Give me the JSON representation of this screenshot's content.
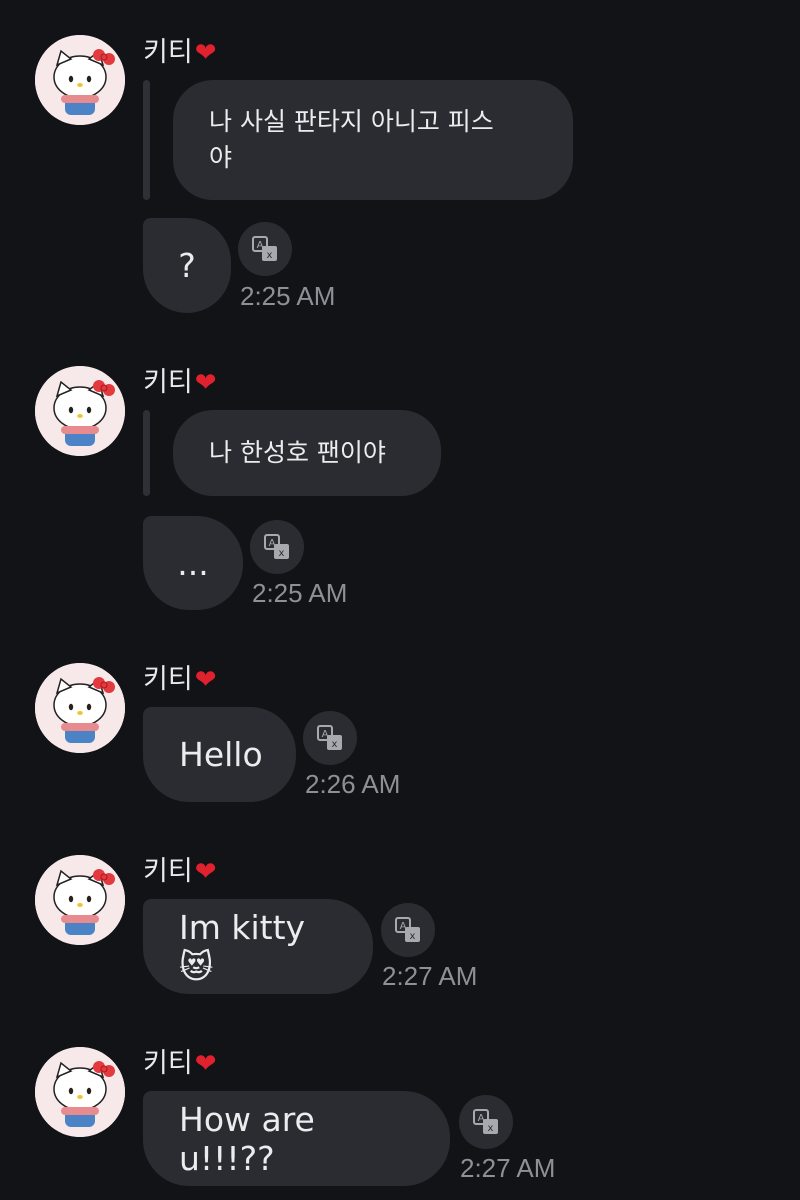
{
  "messages": [
    {
      "sender": "키티",
      "heart": "❤",
      "quote": "나 사실 판타지 아니고 피스\n야",
      "text": "?",
      "time": "2:25 AM"
    },
    {
      "sender": "키티",
      "heart": "❤",
      "quote": "나 한성호 팬이야",
      "text": "...",
      "time": "2:25 AM"
    },
    {
      "sender": "키티",
      "heart": "❤",
      "text": "Hello",
      "time": "2:26 AM"
    },
    {
      "sender": "키티",
      "heart": "❤",
      "text": "Im kitty😻",
      "time": "2:27 AM"
    },
    {
      "sender": "키티",
      "heart": "❤",
      "text": "How are u!!!??",
      "time": "2:27 AM"
    }
  ],
  "icons": {
    "avatar": "hello-kitty-avatar",
    "translate": "translate-icon"
  },
  "colors": {
    "background": "#121316",
    "bubble": "#2a2c31",
    "time": "#8e9097",
    "heart": "#e0212e"
  }
}
